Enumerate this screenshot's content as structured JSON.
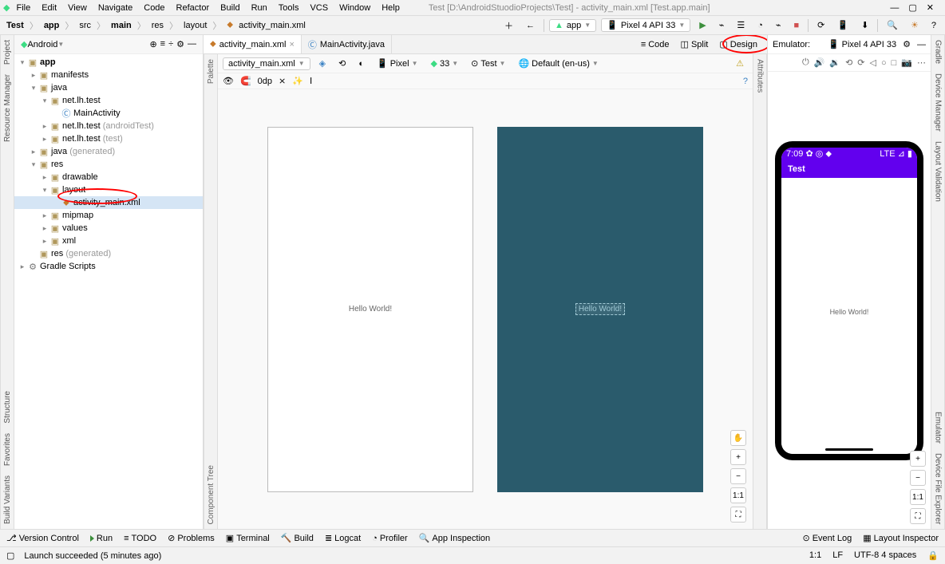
{
  "menubar": {
    "items": [
      "File",
      "Edit",
      "View",
      "Navigate",
      "Code",
      "Refactor",
      "Build",
      "Run",
      "Tools",
      "VCS",
      "Window",
      "Help"
    ],
    "title": "Test [D:\\AndroidStuodioProjects\\Test] - activity_main.xml [Test.app.main]"
  },
  "breadcrumb": [
    "Test",
    "app",
    "src",
    "main",
    "res",
    "layout",
    "activity_main.xml"
  ],
  "toolbar": {
    "run_config": "app",
    "device": "Pixel 4 API 33"
  },
  "sidebar": {
    "header": "Android",
    "tree": {
      "app": "app",
      "manifests": "manifests",
      "java": "java",
      "pkg_main": "net.lh.test",
      "main_activity": "MainActivity",
      "pkg_android_test": "net.lh.test",
      "pkg_android_test_suffix": " (androidTest)",
      "pkg_test": "net.lh.test",
      "pkg_test_suffix": " (test)",
      "java_gen": "java",
      "java_gen_suffix": " (generated)",
      "res": "res",
      "drawable": "drawable",
      "layout": "layout",
      "activity_main": "activity_main.xml",
      "mipmap": "mipmap",
      "values": "values",
      "xml": "xml",
      "res_gen": "res",
      "res_gen_suffix": " (generated)",
      "gradle_scripts": "Gradle Scripts"
    }
  },
  "editor": {
    "tabs": [
      {
        "label": "activity_main.xml",
        "active": true
      },
      {
        "label": "MainActivity.java",
        "active": false
      }
    ],
    "view_modes": {
      "code": "Code",
      "split": "Split",
      "design": "Design"
    },
    "design_toolbar": {
      "file": "activity_main.xml",
      "device": "Pixel",
      "api": "33",
      "theme": "Test",
      "locale": "Default (en-us)"
    },
    "design_toolbar2": {
      "dp": "0dp"
    },
    "canvas": {
      "hello": "Hello World!"
    },
    "zoom": {
      "plus": "+",
      "minus": "−",
      "one": "1:1",
      "fit": "⛶"
    }
  },
  "palette": {
    "label": "Palette",
    "tree_label": "Component Tree"
  },
  "attributes": {
    "label": "Attributes"
  },
  "emulator": {
    "header": "Emulator:",
    "device": "Pixel 4 API 33",
    "status_time": "7:09",
    "status_icons": "✿ ◎ ⬥",
    "status_right": "LTE ⊿ ▮",
    "app_title": "Test",
    "content": "Hello World!",
    "zoom": {
      "plus": "+",
      "minus": "−",
      "one": "1:1",
      "fit": "⛶"
    }
  },
  "gutters": {
    "left": [
      "Project",
      "Resource Manager"
    ],
    "left_bottom": [
      "Structure",
      "Favorites",
      "Build Variants"
    ],
    "right": [
      "Gradle",
      "Device Manager",
      "Layout Validation"
    ],
    "right_bottom": [
      "Emulator",
      "Device File Explorer"
    ]
  },
  "bottom_tools": {
    "vcs": "Version Control",
    "run": "Run",
    "todo": "TODO",
    "problems": "Problems",
    "terminal": "Terminal",
    "build": "Build",
    "logcat": "Logcat",
    "profiler": "Profiler",
    "app_inspection": "App Inspection",
    "event_log": "Event Log",
    "layout_inspector": "Layout Inspector"
  },
  "statusbar": {
    "message": "Launch succeeded (5 minutes ago)",
    "pos": "1:1",
    "encoding": "LF",
    "spaces": "UTF-8  4 spaces"
  }
}
